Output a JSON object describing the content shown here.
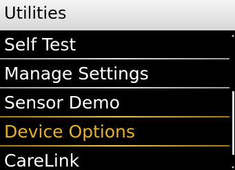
{
  "header": {
    "title": "Utilities"
  },
  "menu": {
    "items": [
      {
        "label": "Self Test",
        "selected": false
      },
      {
        "label": "Manage Settings",
        "selected": false
      },
      {
        "label": "Sensor Demo",
        "selected": false
      },
      {
        "label": "Device Options",
        "selected": true
      },
      {
        "label": "CareLink",
        "selected": false
      }
    ]
  },
  "colors": {
    "background": "#000000",
    "header": "#e6e6e6",
    "text": "#ffffff",
    "selected_text": "#e8b117",
    "selected_divider": "#f2c64a"
  }
}
